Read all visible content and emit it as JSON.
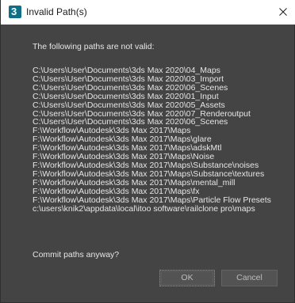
{
  "window": {
    "title": "Invalid Path(s)",
    "icon_glyph": "3",
    "icon_name": "3ds-max-app-icon",
    "close_icon": "close-icon"
  },
  "dialog": {
    "message": "The following paths are not valid:",
    "paths": [
      "C:\\Users\\User\\Documents\\3ds Max 2020\\04_Maps",
      "C:\\Users\\User\\Documents\\3ds Max 2020\\03_Import",
      "C:\\Users\\User\\Documents\\3ds Max 2020\\06_Scenes",
      "C:\\Users\\User\\Documents\\3ds Max 2020\\01_Input",
      "C:\\Users\\User\\Documents\\3ds Max 2020\\05_Assets",
      "C:\\Users\\User\\Documents\\3ds Max 2020\\07_Renderoutput",
      "C:\\Users\\User\\Documents\\3ds Max 2020\\06_Scenes",
      "F:\\Workflow\\Autodesk\\3ds Max 2017\\Maps",
      "F:\\Workflow\\Autodesk\\3ds Max 2017\\Maps\\glare",
      "F:\\Workflow\\Autodesk\\3ds Max 2017\\Maps\\adskMtl",
      "F:\\Workflow\\Autodesk\\3ds Max 2017\\Maps\\Noise",
      "F:\\Workflow\\Autodesk\\3ds Max 2017\\Maps\\Substance\\noises",
      "F:\\Workflow\\Autodesk\\3ds Max 2017\\Maps\\Substance\\textures",
      "F:\\Workflow\\Autodesk\\3ds Max 2017\\Maps\\mental_mill",
      "F:\\Workflow\\Autodesk\\3ds Max 2017\\Maps\\fx",
      "F:\\Workflow\\Autodesk\\3ds Max 2017\\Maps\\Particle Flow Presets",
      "c:\\users\\knik2\\appdata\\local\\itoo software\\railclone pro\\maps"
    ],
    "question": "Commit paths anyway?"
  },
  "buttons": {
    "ok_label": "OK",
    "cancel_label": "Cancel"
  },
  "colors": {
    "dialog_background": "#444444",
    "titlebar_background": "#ffffff",
    "text": "#e6e6e6",
    "icon_accent": "#0e6f86"
  }
}
